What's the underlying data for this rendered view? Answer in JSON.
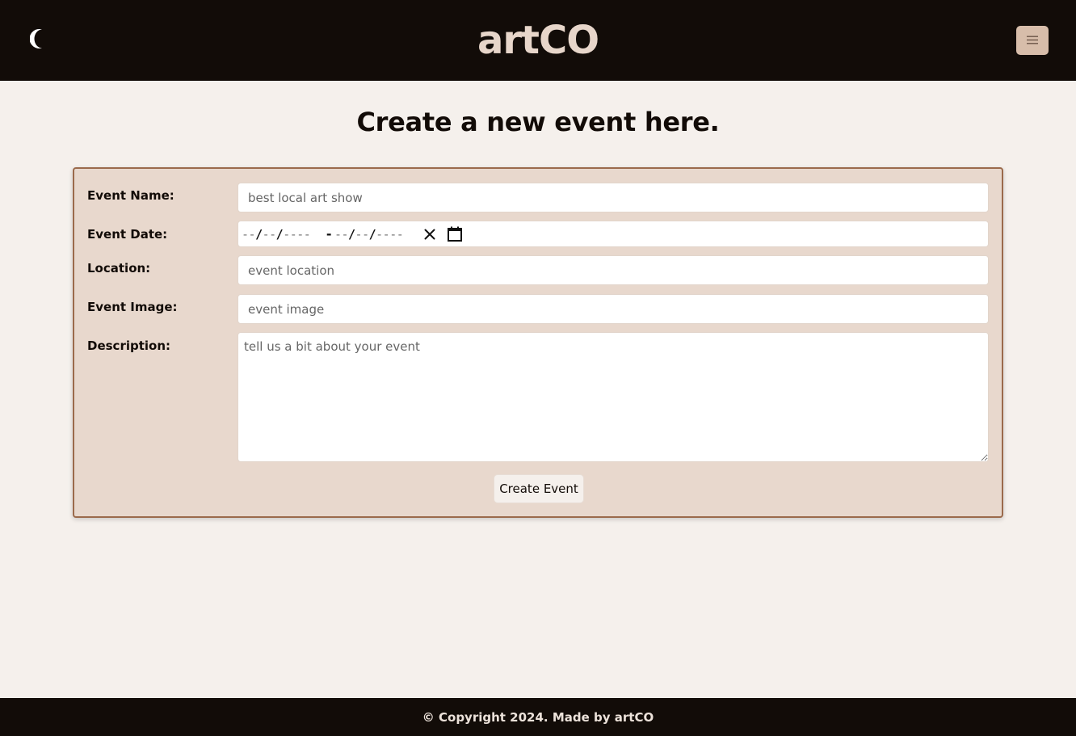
{
  "header": {
    "brand": "artCO",
    "theme_toggle_icon": "moon-icon",
    "menu_icon": "hamburger-menu-icon"
  },
  "main": {
    "title": "Create a new event here."
  },
  "form": {
    "event_name": {
      "label": "Event Name:",
      "placeholder": "best local art show",
      "value": ""
    },
    "event_date": {
      "label": "Event Date:",
      "start_placeholder_parts": [
        "--",
        "--",
        "----"
      ],
      "end_placeholder_parts": [
        "--",
        "--",
        "----"
      ],
      "range_separator": "-",
      "clear_icon": "close-icon",
      "calendar_icon": "calendar-icon"
    },
    "location": {
      "label": "Location:",
      "placeholder": "event location",
      "value": ""
    },
    "event_image": {
      "label": "Event Image:",
      "placeholder": "event image",
      "value": ""
    },
    "description": {
      "label": "Description:",
      "placeholder": "tell us a bit about your event",
      "value": ""
    },
    "submit_label": "Create Event"
  },
  "footer": {
    "text": "© Copyright 2024. Made by artCO"
  },
  "colors": {
    "header_bg": "#120c08",
    "page_bg": "#f5f0ec",
    "card_bg": "#e8d8cd",
    "card_border": "#9b6a4c",
    "brand": "#e7d6ca",
    "menu_button_bg": "#d7bdaa"
  }
}
